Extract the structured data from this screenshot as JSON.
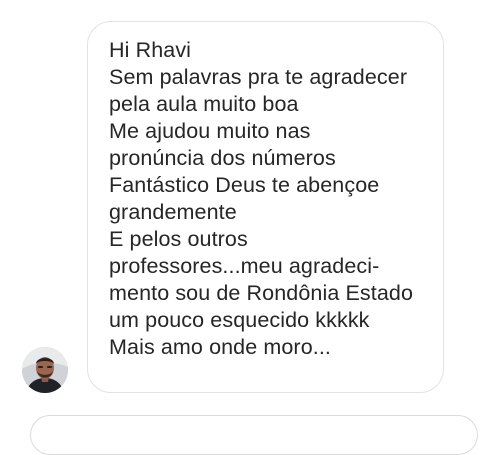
{
  "conversation": {
    "message": {
      "lines": [
        "Hi Rhavi",
        "Sem palavras pra te agradecer",
        "pela aula muito boa",
        "Me ajudou muito nas",
        "pronúncia dos números",
        "Fantástico Deus te abençoe",
        "grandemente",
        "E pelos outros",
        "professores...meu agradeci-",
        "mento sou de Rondônia Estado",
        "um pouco esquecido kkkkk",
        "Mais amo onde moro..."
      ]
    },
    "sender": {
      "avatar_icon": "profile-photo-avatar"
    }
  },
  "colors": {
    "text": "#262626",
    "bubble_border": "#e3e3e3",
    "background": "#ffffff"
  }
}
